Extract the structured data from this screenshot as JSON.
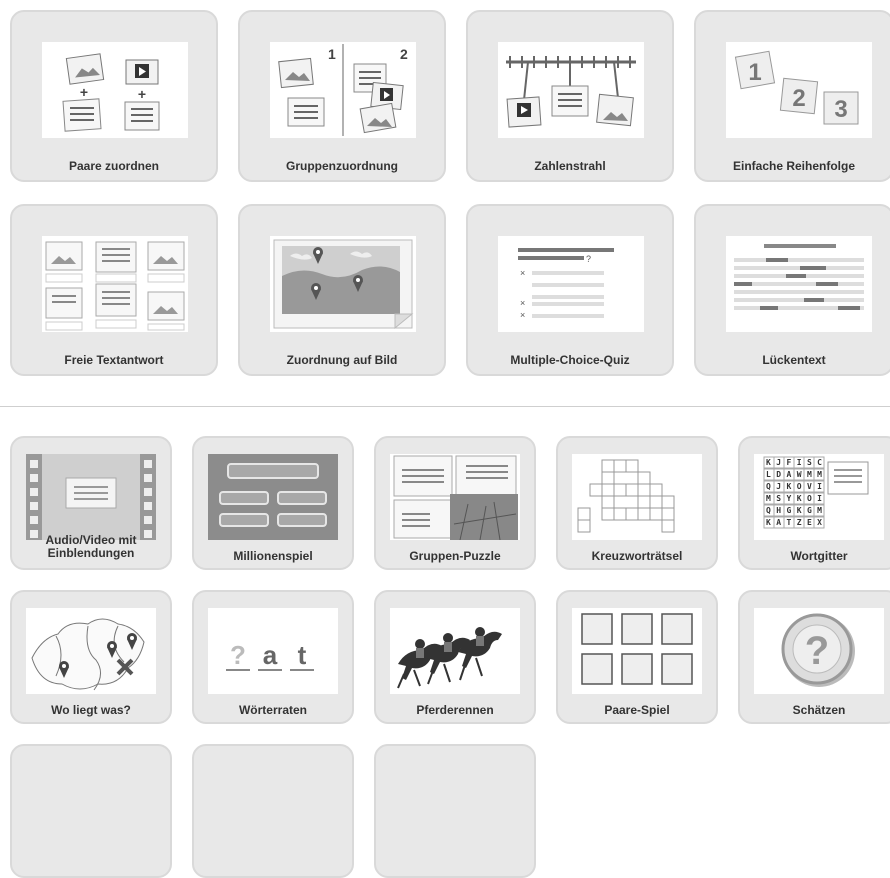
{
  "section1": {
    "tiles": [
      {
        "label": "Paare zuordnen",
        "icon": "pairs-icon"
      },
      {
        "label": "Gruppenzuordnung",
        "icon": "group-assignment-icon"
      },
      {
        "label": "Zahlenstrahl",
        "icon": "number-line-icon"
      },
      {
        "label": "Einfache Reihenfolge",
        "icon": "ordering-icon"
      },
      {
        "label": "Freie Textantwort",
        "icon": "free-text-icon"
      },
      {
        "label": "Zuordnung auf Bild",
        "icon": "image-map-icon"
      },
      {
        "label": "Multiple-Choice-Quiz",
        "icon": "multiple-choice-icon"
      },
      {
        "label": "Lückentext",
        "icon": "cloze-text-icon"
      }
    ],
    "group_numbers": [
      "1",
      "2"
    ],
    "order_numbers": [
      "1",
      "2",
      "3"
    ]
  },
  "section2": {
    "tiles": [
      {
        "label": "Audio/Video mit Einblendungen",
        "line1": "Audio/Video mit",
        "line2": "Einblendungen",
        "icon": "video-overlay-icon"
      },
      {
        "label": "Millionenspiel",
        "icon": "millionaire-icon"
      },
      {
        "label": "Gruppen-Puzzle",
        "icon": "puzzle-icon"
      },
      {
        "label": "Kreuzworträtsel",
        "icon": "crossword-icon"
      },
      {
        "label": "Wortgitter",
        "icon": "word-grid-icon"
      },
      {
        "label": "Wo liegt was?",
        "icon": "map-pins-icon"
      },
      {
        "label": "Wörterraten",
        "icon": "word-guess-icon"
      },
      {
        "label": "Pferderennen",
        "icon": "horse-race-icon"
      },
      {
        "label": "Paare-Spiel",
        "icon": "memory-icon"
      },
      {
        "label": "Schätzen",
        "icon": "question-coin-icon"
      }
    ],
    "word_guess_letters": [
      "?",
      "a",
      "t"
    ],
    "word_grid_rows": [
      "KJFISC",
      "LDAWMM",
      "QJKOVI",
      "MSYKOI",
      "QHGKGM",
      "KATZEX"
    ],
    "question_mark": "?"
  },
  "colors": {
    "tile_bg": "#e8e8e8",
    "tile_border": "#d9d9d9",
    "label": "#333333"
  }
}
